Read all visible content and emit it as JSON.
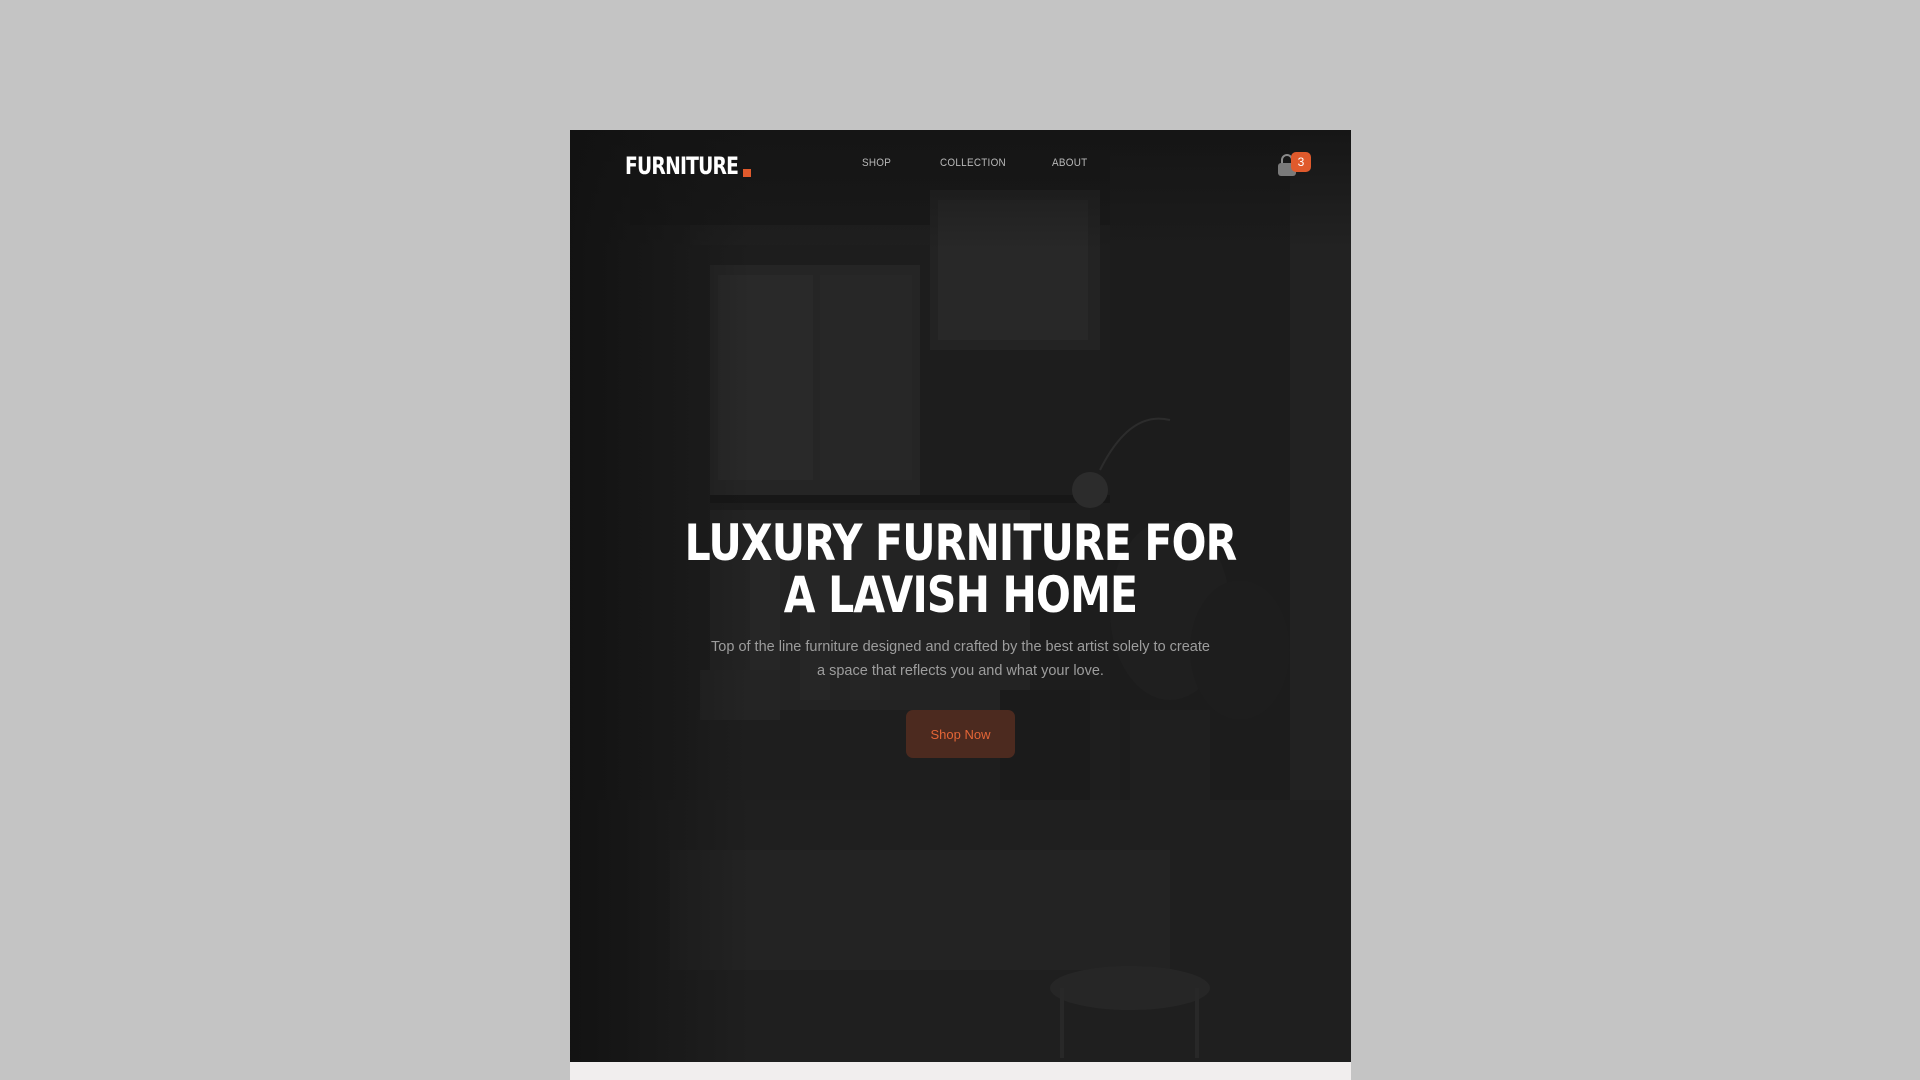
{
  "brand": {
    "name": "FURNITURE",
    "accent_color": "#e05a2c"
  },
  "nav": {
    "links": [
      {
        "label": "SHOP"
      },
      {
        "label": "COLLECTION"
      },
      {
        "label": "ABOUT"
      }
    ],
    "cart": {
      "icon": "shopping-bag-icon",
      "count": "3"
    }
  },
  "hero": {
    "headline_line1": "LUXURY FURNITURE FOR",
    "headline_line2": "A LAVISH HOME",
    "subtitle": "Top of the line furniture designed and crafted by the best artist solely to create a space that reflects you and what your love.",
    "cta_label": "Shop Now"
  }
}
